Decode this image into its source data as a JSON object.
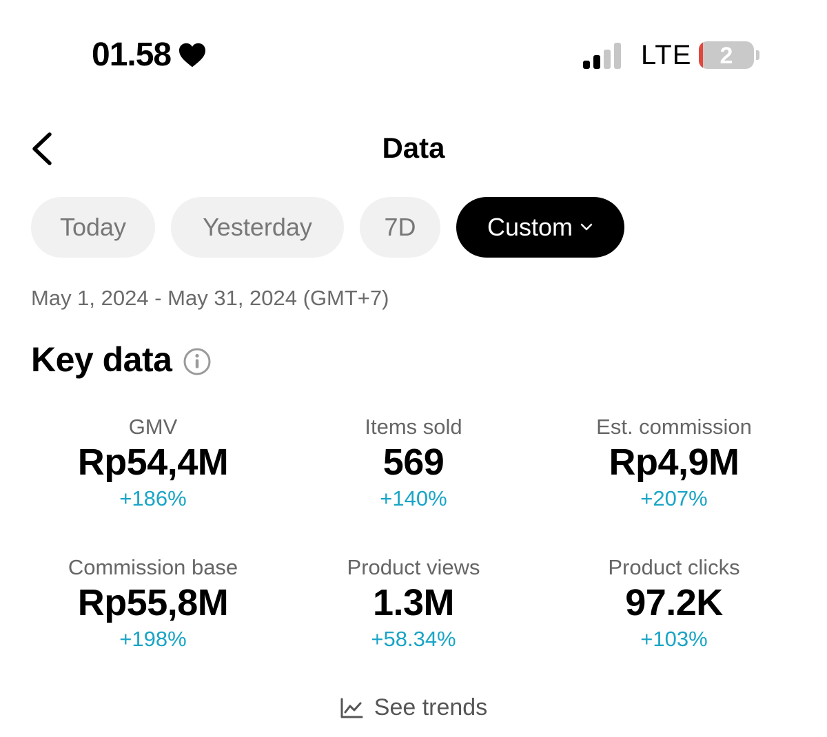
{
  "status_bar": {
    "time": "01.58",
    "network": "LTE",
    "battery_level": "2",
    "heart_icon": "heart-icon",
    "signal_bars_active": 2,
    "signal_bars_total": 4
  },
  "nav": {
    "title": "Data",
    "back_icon": "chevron-left-icon"
  },
  "filters": {
    "today": "Today",
    "yesterday": "Yesterday",
    "seven_days": "7D",
    "custom": "Custom",
    "selected": "Custom"
  },
  "date_range": "May 1, 2024 - May 31, 2024 (GMT+7)",
  "key_data": {
    "title": "Key data",
    "info_icon": "info-icon",
    "metrics": [
      {
        "label": "GMV",
        "value": "Rp54,4M",
        "delta": "+186%"
      },
      {
        "label": "Items sold",
        "value": "569",
        "delta": "+140%"
      },
      {
        "label": "Est. commission",
        "value": "Rp4,9M",
        "delta": "+207%"
      },
      {
        "label": "Commission base",
        "value": "Rp55,8M",
        "delta": "+198%"
      },
      {
        "label": "Product views",
        "value": "1.3M",
        "delta": "+58.34%"
      },
      {
        "label": "Product clicks",
        "value": "97.2K",
        "delta": "+103%"
      }
    ]
  },
  "see_trends": "See trends",
  "colors": {
    "accent_delta": "#1aa5c6",
    "chip_bg": "#f1f1f1",
    "chip_active_bg": "#000000",
    "battery_low": "#e2463c"
  }
}
